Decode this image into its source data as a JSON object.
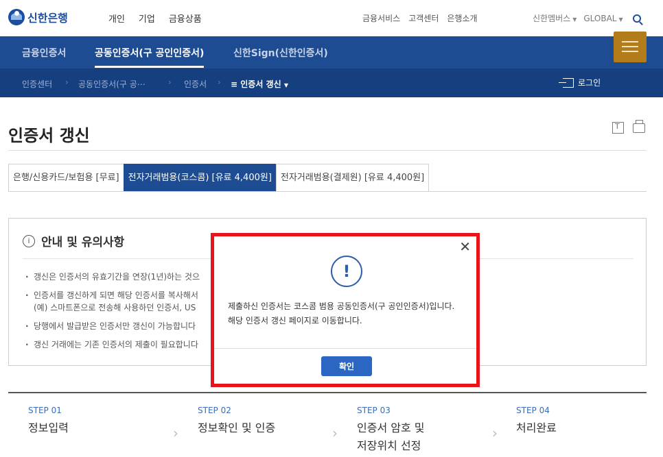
{
  "header": {
    "logo_text": "신한은행",
    "gnb": [
      "개인",
      "기업",
      "금융상품"
    ],
    "util": [
      "금융서비스",
      "고객센터",
      "은행소개"
    ],
    "util2": [
      "신한멤버스",
      "GLOBAL"
    ]
  },
  "tabs": [
    "금융인증서",
    "공동인증서(구 공인인증서)",
    "신한Sign(신한인증서)"
  ],
  "breadcrumb": {
    "items": [
      "인증센터",
      "공동인증서(구 공⋯",
      "인증서",
      "≡ 인증서 갱신"
    ],
    "login": "로그인"
  },
  "page": {
    "title": "인증서 갱신",
    "subtabs": [
      "은행/신용카드/보험용 [무료]",
      "전자거래범용(코스콤) [유료 4,400원]",
      "전자거래범용(결제원) [유료 4,400원]"
    ]
  },
  "notice": {
    "title": "안내 및 유의사항",
    "items": [
      "갱신은 인증서의 유효기간을 연장(1년)하는 것으",
      "인증서를 갱신하게 되면 해당 인증서를 복사해서",
      "(예) 스마트폰으로 전송해 사용하던 인증서, US",
      "당행에서 발급받은 인증서만 갱신이 가능합니다",
      "갱신 거래에는 기존 인증서의 제출이 필요합니다"
    ]
  },
  "steps": [
    {
      "num": "STEP 01",
      "label": "정보입력"
    },
    {
      "num": "STEP 02",
      "label": "정보확인 및 인증"
    },
    {
      "num": "STEP 03",
      "label": "인증서 암호 및\n저장위치 선정"
    },
    {
      "num": "STEP 04",
      "label": "처리완료"
    }
  ],
  "dialog": {
    "close": "✕",
    "icon": "!",
    "message_line1": "제출하신 인증서는 코스콤 범용 공동인증서(구 공인인증서)입니다.",
    "message_line2": "해당 인증서 갱신 페이지로 이동합니다.",
    "confirm": "확인"
  },
  "colors": {
    "primary": "#1e4c92",
    "breadcrumb_bg": "#163f80",
    "menu_button": "#b37c1a",
    "highlight": "#e8141c",
    "button": "#2b67c2"
  }
}
